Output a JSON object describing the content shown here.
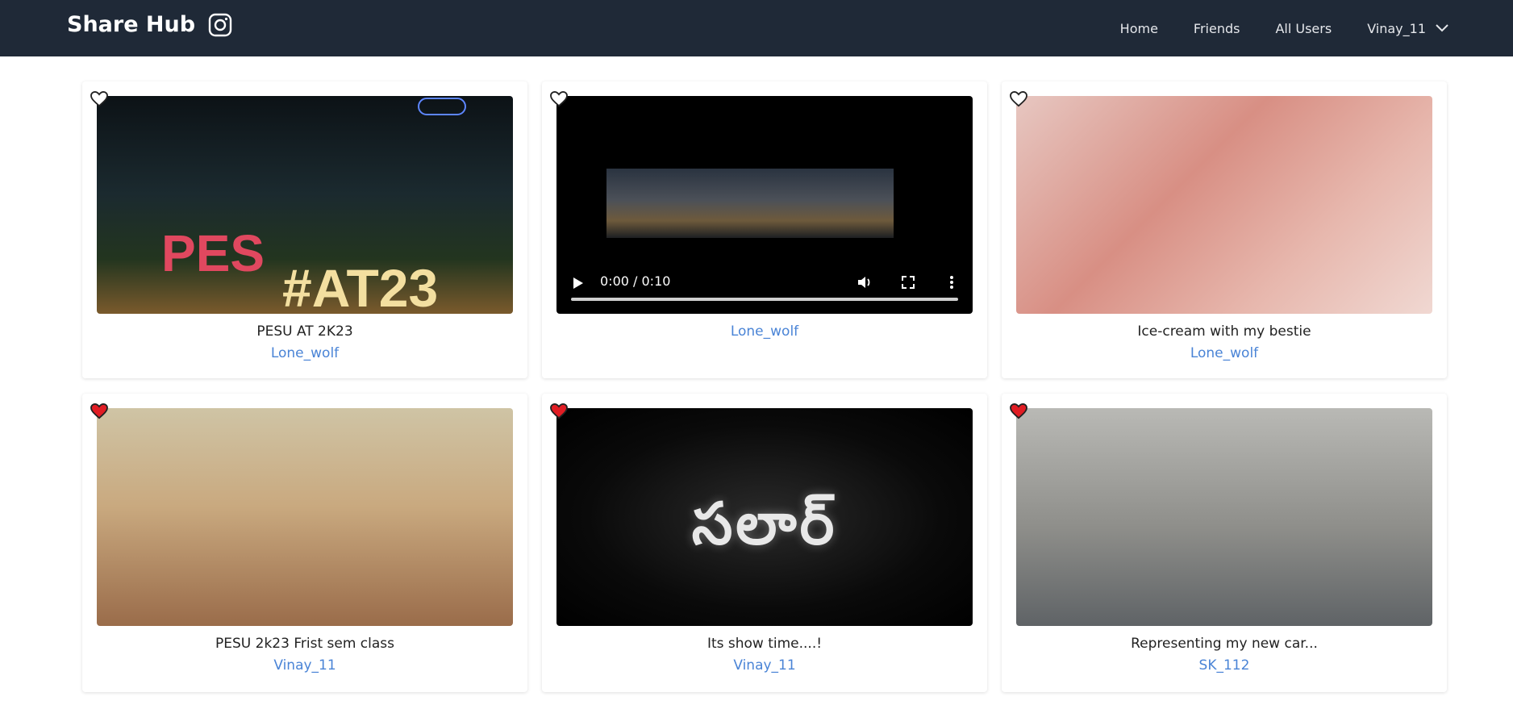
{
  "app": {
    "title": "Share Hub"
  },
  "nav": {
    "home": "Home",
    "friends": "Friends",
    "all_users": "All Users",
    "user": "Vinay_11"
  },
  "colors": {
    "navbar_bg": "#1f2937",
    "link_color": "#4a84d6",
    "liked_heart": "#e11d24"
  },
  "posts": [
    {
      "caption": "PESU AT 2K23",
      "author": "Lone_wolf",
      "liked": false,
      "media_type": "image"
    },
    {
      "caption": "",
      "author": "Lone_wolf",
      "liked": false,
      "media_type": "video",
      "video_time": "0:00 / 0:10"
    },
    {
      "caption": "Ice-cream with my bestie",
      "author": "Lone_wolf",
      "liked": false,
      "media_type": "image"
    },
    {
      "caption": "PESU 2k23 Frist sem class",
      "author": "Vinay_11",
      "liked": true,
      "media_type": "image"
    },
    {
      "caption": "Its show time....!",
      "author": "Vinay_11",
      "liked": true,
      "media_type": "image"
    },
    {
      "caption": "Representing my new car...",
      "author": "SK_112",
      "liked": true,
      "media_type": "image"
    }
  ],
  "media_text": {
    "pes_sign": "PES",
    "at_sign": "#AT23",
    "salaar_title": "సలార్"
  }
}
